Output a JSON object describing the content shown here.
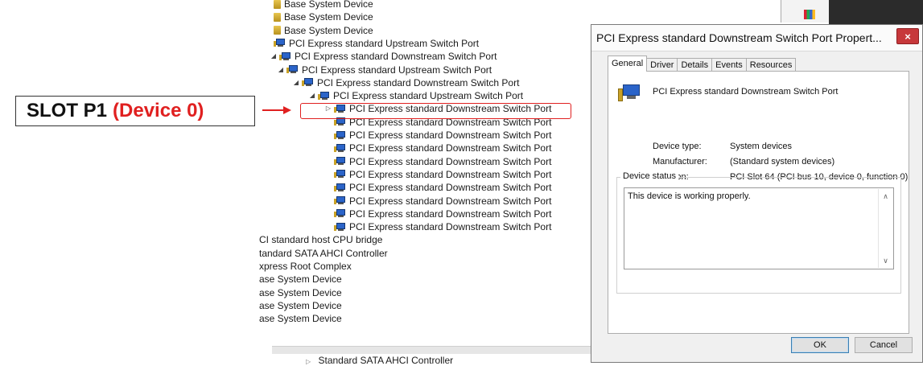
{
  "annotation": {
    "label_text": "SLOT P1",
    "label_highlight": "(Device 0)",
    "highlight_color": "#e02020"
  },
  "tree": {
    "rows": [
      {
        "label": "Base System Device",
        "indent": 0,
        "icon": "system-device-icon",
        "expander": ""
      },
      {
        "label": "Base System Device",
        "indent": 0,
        "icon": "system-device-icon",
        "expander": ""
      },
      {
        "label": "Base System Device",
        "indent": 0,
        "icon": "system-device-icon",
        "expander": ""
      },
      {
        "label": "PCI Express standard Upstream Switch Port",
        "indent": 0,
        "icon": "pci-device-icon",
        "expander": ""
      },
      {
        "label": "PCI Express standard Downstream Switch Port",
        "indent": 1,
        "icon": "pci-device-icon",
        "expander": "◢"
      },
      {
        "label": "PCI Express standard Upstream Switch Port",
        "indent": 2,
        "icon": "pci-device-icon",
        "expander": "◢"
      },
      {
        "label": "PCI Express standard Downstream Switch Port",
        "indent": 3,
        "icon": "pci-device-icon",
        "expander": "◢"
      },
      {
        "label": "PCI Express standard Upstream Switch Port",
        "indent": 4,
        "icon": "pci-device-icon",
        "expander": "◢"
      },
      {
        "label": "PCI Express standard Downstream Switch Port",
        "indent": 5,
        "icon": "pci-device-icon",
        "expander": "▷",
        "selected": true
      },
      {
        "label": "PCI Express standard Downstream Switch Port",
        "indent": 5,
        "icon": "pci-device-icon",
        "expander": ""
      },
      {
        "label": "PCI Express standard Downstream Switch Port",
        "indent": 5,
        "icon": "pci-device-icon",
        "expander": ""
      },
      {
        "label": "PCI Express standard Downstream Switch Port",
        "indent": 5,
        "icon": "pci-device-icon",
        "expander": ""
      },
      {
        "label": "PCI Express standard Downstream Switch Port",
        "indent": 5,
        "icon": "pci-device-icon",
        "expander": ""
      },
      {
        "label": "PCI Express standard Downstream Switch Port",
        "indent": 5,
        "icon": "pci-device-icon",
        "expander": ""
      },
      {
        "label": "PCI Express standard Downstream Switch Port",
        "indent": 5,
        "icon": "pci-device-icon",
        "expander": ""
      },
      {
        "label": "PCI Express standard Downstream Switch Port",
        "indent": 5,
        "icon": "pci-device-icon",
        "expander": ""
      },
      {
        "label": "PCI Express standard Downstream Switch Port",
        "indent": 5,
        "icon": "pci-device-icon",
        "expander": ""
      },
      {
        "label": "PCI Express standard Downstream Switch Port",
        "indent": 5,
        "icon": "pci-device-icon",
        "expander": ""
      },
      {
        "label": "CI standard host CPU bridge",
        "indent": -1,
        "icon": "",
        "expander": ""
      },
      {
        "label": "tandard SATA AHCI Controller",
        "indent": -1,
        "icon": "",
        "expander": ""
      },
      {
        "label": "xpress Root Complex",
        "indent": -1,
        "icon": "",
        "expander": ""
      },
      {
        "label": "ase System Device",
        "indent": -1,
        "icon": "",
        "expander": ""
      },
      {
        "label": "ase System Device",
        "indent": -1,
        "icon": "",
        "expander": ""
      },
      {
        "label": "ase System Device",
        "indent": -1,
        "icon": "",
        "expander": ""
      },
      {
        "label": "ase System Device",
        "indent": -1,
        "icon": "",
        "expander": ""
      }
    ],
    "bottom_row_label": "Standard SATA AHCI Controller"
  },
  "dialog": {
    "title": "PCI Express standard Downstream Switch Port Propert...",
    "close_glyph": "×",
    "tabs": [
      "General",
      "Driver",
      "Details",
      "Events",
      "Resources"
    ],
    "active_tab": "General",
    "device_name": "PCI Express standard Downstream Switch Port",
    "props": [
      {
        "key": "Device type:",
        "value": "System devices"
      },
      {
        "key": "Manufacturer:",
        "value": "(Standard system devices)"
      },
      {
        "key": "Location:",
        "value": "PCI Slot 64 (PCI bus 10, device 0, function 0)"
      }
    ],
    "status_legend": "Device status",
    "status_text": "This device is working properly.",
    "ok_label": "OK",
    "cancel_label": "Cancel"
  }
}
